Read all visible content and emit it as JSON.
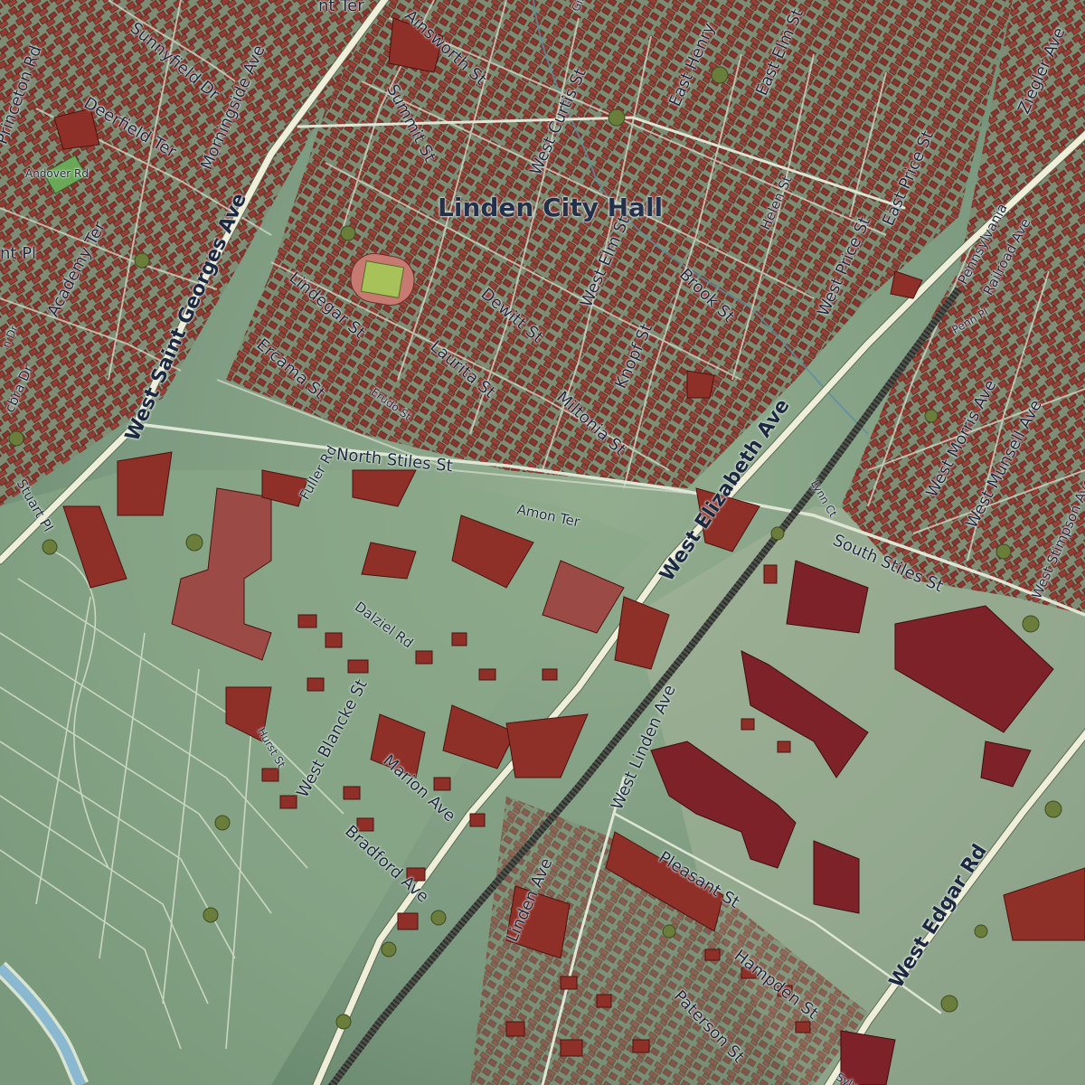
{
  "map": {
    "poi": {
      "city_hall": "Linden City Hall"
    },
    "streets": {
      "w_st_georges": "West Saint Georges Ave",
      "w_elizabeth": "West Elizabeth Ave",
      "w_edgar": "West Edgar Rd",
      "n_stiles": "North Stiles St",
      "s_stiles": "South Stiles St",
      "w_linden": "West Linden Ave",
      "linden": "Linden Ave",
      "pleasant": "Pleasant St",
      "hampden": "Hampden St",
      "paterson": "Paterson St",
      "ainsworth": "Ainsworth St",
      "summit": "Summit St",
      "w_curtis": "West Curtis St",
      "e_henry": "East Henry",
      "e_elm": "East Elm St",
      "e_price": "East Price St",
      "ziegler": "Ziegler Ave",
      "pennsylvania": "Pennsylvania",
      "railroad": "Railroad Ave",
      "w_price": "West Price St",
      "brook": "Brook St",
      "helen": "Helen St",
      "dewitt": "Dewitt St",
      "w_elm": "West Elm St",
      "knopf": "Knopf St",
      "laurita": "Laurita St",
      "miltonia": "Miltonia St",
      "lindegar": "Lindegar St",
      "ercama": "Ercama St",
      "erudo": "Erudo St",
      "amon": "Amon Ter",
      "fuller": "Fuller Rd",
      "dalziel": "Dalziel Rd",
      "w_blancke": "West Blancke St",
      "marion": "Marion Ave",
      "bradford": "Bradford Ave",
      "hurst": "Hurst St",
      "morningside": "Morningside Ave",
      "sunnyfield": "Sunnyfield Dr",
      "deerfield": "Deerfield Ter",
      "princeton": "Princeton Rd",
      "academy": "Academy Ter",
      "andover": "Andover Rd",
      "stuart": "Stuart Pl",
      "cobra": "cbra Dr",
      "w_morris": "West Morris Ave",
      "w_munsell": "West Munsell Ave",
      "w_stimpson": "West Stimpson Ave",
      "penn_pl": "Penn Pl",
      "lynn": "Lynn Ct",
      "frag_ter": "nt Ter",
      "frag_pl": "nt Pl",
      "frag_dr": "n Dr",
      "frag_gi": "Gibb",
      "frag_sylv": "Sylv"
    },
    "colors": {
      "ground": "#7d9a80",
      "building": "#8e2f28",
      "text": "#1c2740",
      "water": "#8ab8d0"
    }
  }
}
